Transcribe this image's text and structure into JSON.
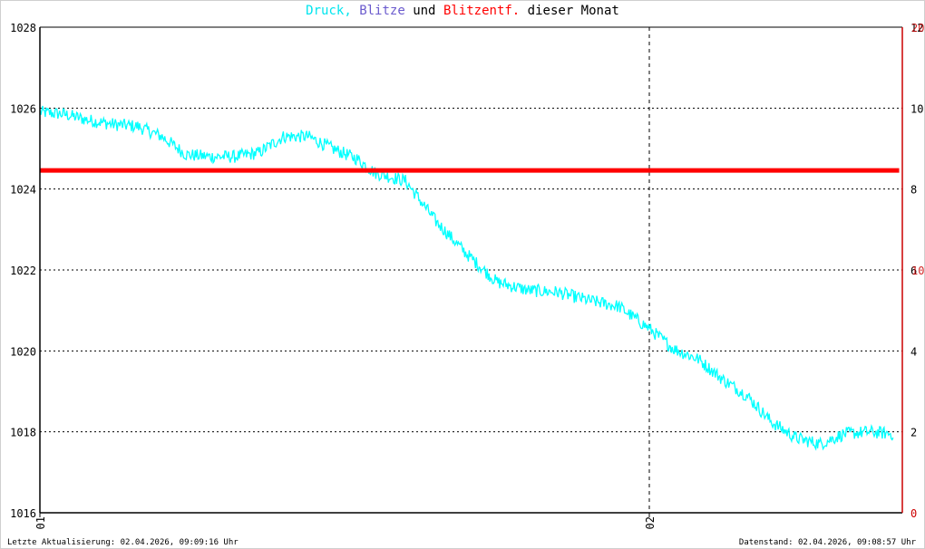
{
  "title": {
    "part1": "Druck,",
    "part2": "Blitze",
    "part3": "und",
    "part4": "Blitzentf.",
    "part5": "dieser Monat"
  },
  "colors": {
    "pressure": "#00ffff",
    "lightning": "#6a5acd",
    "distance": "#ff0000",
    "right_axis": "#cc0000",
    "axis": "#000000",
    "grid": "#000000"
  },
  "footer": {
    "left": "Letzte Aktualisierung: 02.04.2026, 09:09:16 Uhr",
    "right": "Datenstand: 02.04.2026, 09:08:57 Uhr"
  },
  "chart_data": {
    "type": "line",
    "x_ticks": [
      "01",
      "02"
    ],
    "left_axis": {
      "ylim": [
        1016,
        1028
      ],
      "ticks": [
        "1016",
        "1018",
        "1020",
        "1022",
        "1024",
        "1026",
        "1028"
      ]
    },
    "right_axis_lightning": {
      "ylim": [
        0,
        12
      ],
      "ticks": [
        "0",
        "2",
        "4",
        "6",
        "8",
        "10",
        "12"
      ]
    },
    "right_axis_distance": {
      "ylim": [
        0,
        20
      ],
      "ticks": [
        "10",
        "20"
      ]
    },
    "series": [
      {
        "name": "Druck",
        "axis": "left",
        "x": [
          0.0,
          0.04,
          0.08,
          0.12,
          0.16,
          0.2,
          0.24,
          0.28,
          0.32,
          0.36,
          0.4,
          0.44,
          0.48,
          0.52,
          0.55,
          0.6,
          0.65,
          0.7,
          0.75,
          0.8,
          0.85,
          0.9,
          0.95,
          1.0,
          1.04,
          1.08,
          1.12,
          1.16,
          1.2,
          1.24,
          1.28,
          1.32,
          1.36,
          1.4
        ],
        "y": [
          1025.9,
          1025.85,
          1025.7,
          1025.6,
          1025.55,
          1025.3,
          1024.85,
          1024.8,
          1024.8,
          1024.9,
          1025.3,
          1025.3,
          1025.0,
          1024.75,
          1024.4,
          1024.2,
          1023.2,
          1022.4,
          1021.7,
          1021.5,
          1021.45,
          1021.25,
          1021.1,
          1020.55,
          1020.05,
          1019.8,
          1019.3,
          1018.9,
          1018.25,
          1017.85,
          1017.7,
          1017.95,
          1018.0,
          1017.95
        ]
      },
      {
        "name": "Blitzentf.",
        "axis": "right_distance",
        "x": [
          0.0,
          1.41
        ],
        "y": [
          14.1,
          14.1
        ]
      }
    ],
    "grid": true
  }
}
